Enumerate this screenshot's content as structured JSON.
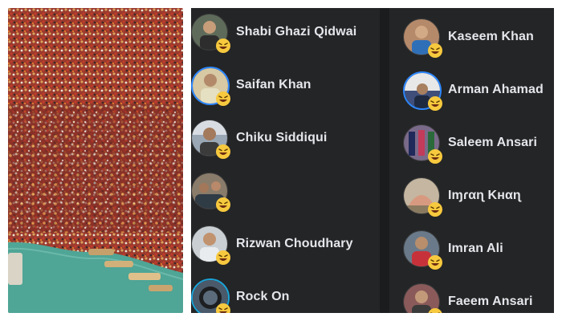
{
  "reactions": {
    "left_column": [
      {
        "name": "Shabi Ghazi Qidwai",
        "reaction_icon": "haha-emoji-icon",
        "avatar_color": "#5f6b5a"
      },
      {
        "name": "Saifan Khan",
        "reaction_icon": "haha-emoji-icon",
        "avatar_color": "#d7c9a3"
      },
      {
        "name": "Chiku Siddiqui",
        "reaction_icon": "haha-emoji-icon",
        "avatar_color": "#9aa7b5"
      },
      {
        "name": "",
        "reaction_icon": "haha-emoji-icon",
        "avatar_color": "#8a7c6a"
      },
      {
        "name": "Rizwan Choudhary",
        "reaction_icon": "haha-emoji-icon",
        "avatar_color": "#c9cfd3"
      },
      {
        "name": "Rock On",
        "reaction_icon": "haha-emoji-icon",
        "avatar_color": "#4a5a6a"
      }
    ],
    "right_column": [
      {
        "name": "Kaseem Khan",
        "reaction_icon": "haha-emoji-icon",
        "avatar_color": "#b58a6a"
      },
      {
        "name": "Arman Ahamad",
        "reaction_icon": "haha-emoji-icon",
        "avatar_color": "#3f4f7a"
      },
      {
        "name": "Saleem Ansari",
        "reaction_icon": "haha-emoji-icon",
        "avatar_color": "#7a6a8a"
      },
      {
        "name": "Iɱɾαɳ Kнαɳ",
        "reaction_icon": "haha-emoji-icon",
        "avatar_color": "#c4b6a0"
      },
      {
        "name": "Imran Ali",
        "reaction_icon": "haha-emoji-icon",
        "avatar_color": "#6a7a8a"
      },
      {
        "name": "Faeem Ansari",
        "reaction_icon": "haha-emoji-icon",
        "avatar_color": "#8a5a5a"
      }
    ]
  },
  "colors": {
    "panel_bg": "#242526",
    "name_text": "#e4e6eb",
    "haha_yellow": "#f7c93e",
    "water": "#4fa596"
  }
}
